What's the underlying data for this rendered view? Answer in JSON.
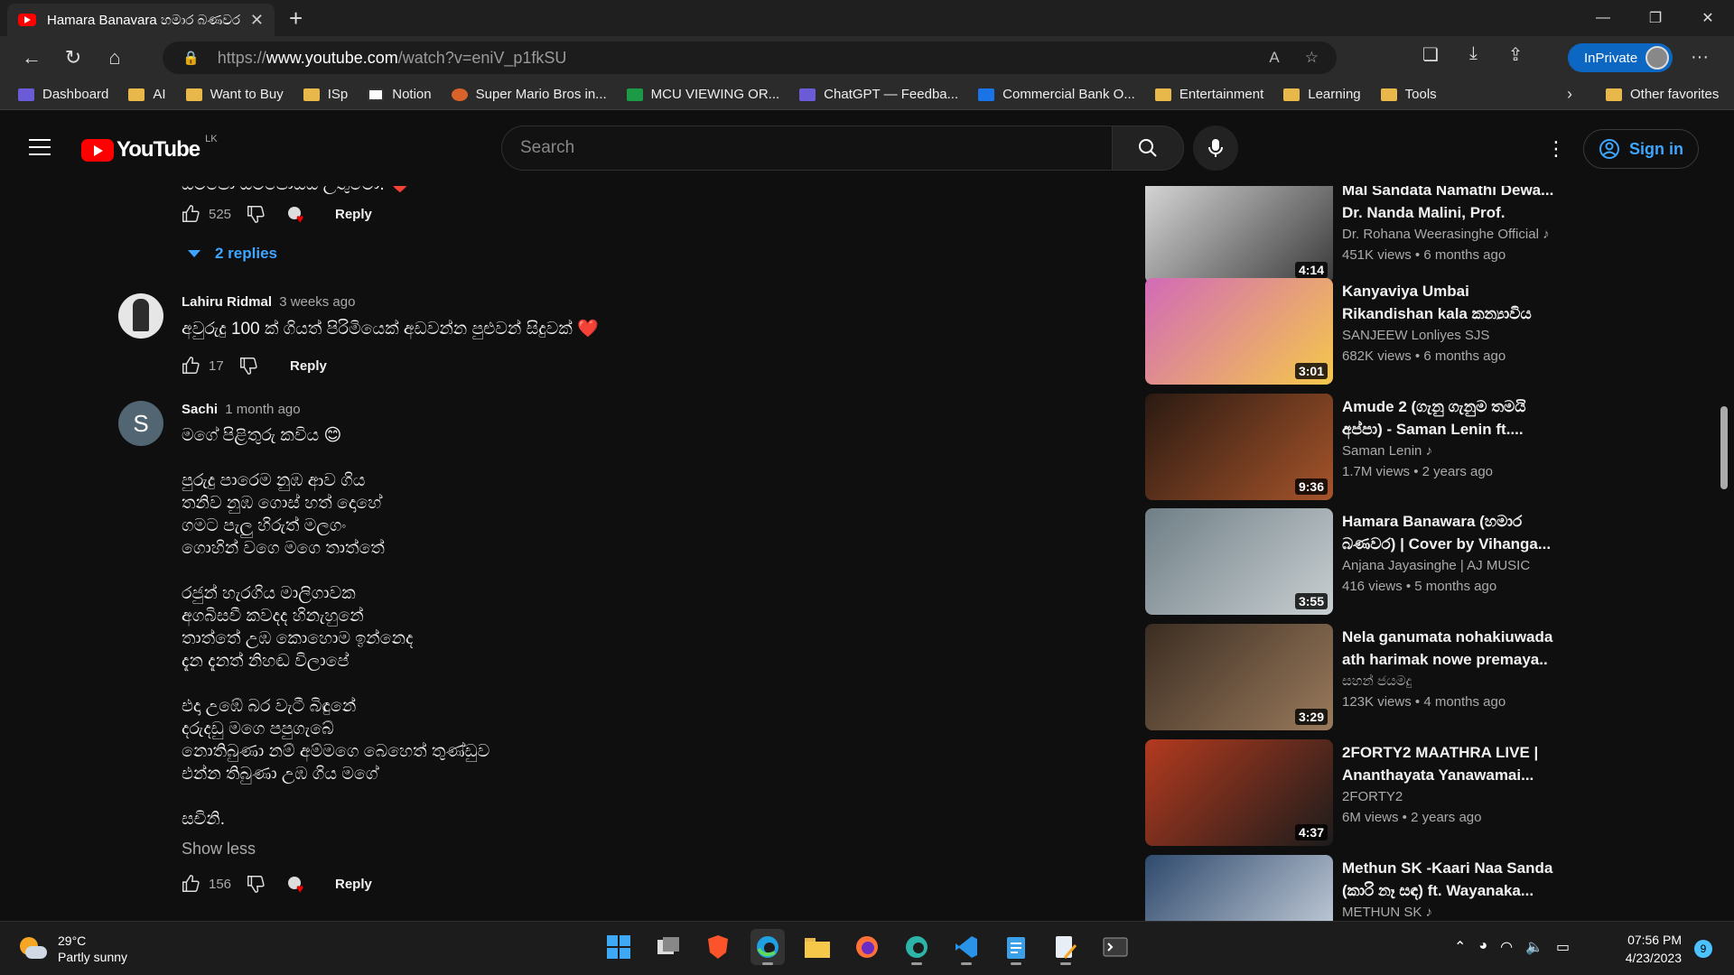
{
  "browser": {
    "tab_title": "Hamara Banavara හමාර බණවර",
    "url_prefix": "https://",
    "url_domain": "www.youtube.com",
    "url_path": "/watch?v=eniV_p1fkSU",
    "inprivate_label": "InPrivate",
    "bookmarks": [
      {
        "label": "Dashboard",
        "icon": "dashboard-icon"
      },
      {
        "label": "AI",
        "icon": "folder-icon"
      },
      {
        "label": "Want to Buy",
        "icon": "folder-icon"
      },
      {
        "label": "ISp",
        "icon": "folder-icon"
      },
      {
        "label": "Notion",
        "icon": "notion-icon"
      },
      {
        "label": "Super Mario Bros in...",
        "icon": "mario-icon"
      },
      {
        "label": "MCU VIEWING OR...",
        "icon": "sheets-icon"
      },
      {
        "label": "ChatGPT — Feedba...",
        "icon": "form-icon"
      },
      {
        "label": "Commercial Bank O...",
        "icon": "bank-icon"
      },
      {
        "label": "Entertainment",
        "icon": "folder-icon"
      },
      {
        "label": "Learning",
        "icon": "folder-icon"
      },
      {
        "label": "Tools",
        "icon": "folder-icon"
      }
    ],
    "other_favorites": "Other favorites"
  },
  "youtube": {
    "logo_text": "YouTube",
    "country": "LK",
    "search_placeholder": "Search",
    "sign_in": "Sign in"
  },
  "comments": {
    "top_partial_text": "සමපෝ සමපෝසය උතුමො. ❤️",
    "top_likes": "525",
    "replies_label": "2 replies",
    "reply_label": "Reply",
    "items": [
      {
        "author": "Lahiru Ridmal",
        "time": "3 weeks ago",
        "text": "අවුරුදු 100 ක් ගියත් පිරිමියෙක් අඩවන්න පුළුවන් සිදුවක් ❤️",
        "likes": "17"
      },
      {
        "author": "Sachi",
        "initial": "S",
        "time": "1 month ago",
        "lines": [
          "මගේ පිළිතුරු කවිය 😊",
          "",
          "පුරුදු පාරෙම නුඹ ආව ගිය",
          "තනිව නුඹ ගොස් හත් දොහේ",
          "ගමට පැලු හිරුත් මලගං",
          "ගොහින් වගෙ මගෙ තාත්තේ",
          "",
          "රජුන් හැරගිය මාලිගාවක",
          "අගබිසවී කවදද හිනැහුනේ",
          "තාත්තේ උඹ කොහොම ඉන්නෙද",
          "දැන දැනත් නිහඬ විලාපේ",
          "",
          "එදා උඹේ බර වැටී බිඳුනේ",
          "දරුදඩු මගෙ පපුගැබේ",
          "නොතිබුණා නම් අම්මගෙ බෙහෙත් තුණ්ඩුව",
          "එන්න තිබුණා උඹ ගිය මගේ",
          "",
          "සචිනි."
        ],
        "show_less": "Show less",
        "likes": "156"
      }
    ]
  },
  "related": [
    {
      "title": "Mal Sandata Namathi Dewa... Dr. Nanda Malini, Prof. Sunil...",
      "channel": "Dr. Rohana Weerasinghe Official",
      "music": true,
      "views": "451K views",
      "age": "6 months ago",
      "duration": "4:14",
      "thumb_colors": [
        "#d9d9d9",
        "#3a3a3a"
      ]
    },
    {
      "title": "Kanyaviya Umbai Rikandishan kala කන්‍යාවිය උඹයි...",
      "channel": "SANJEEW Lonliyes SJS",
      "music": false,
      "views": "682K views",
      "age": "6 months ago",
      "duration": "3:01",
      "thumb_colors": [
        "#d26ab8",
        "#f5c84a"
      ]
    },
    {
      "title": "Amude 2 (ගැනු ගැනුම තමයි අප්පා) - Saman Lenin ft....",
      "channel": "Saman Lenin",
      "music": true,
      "views": "1.7M views",
      "age": "2 years ago",
      "duration": "9:36",
      "thumb_colors": [
        "#2a1a12",
        "#a6542a"
      ]
    },
    {
      "title": "Hamara Banawara (හමාර බණවර) | Cover by Vihanga...",
      "channel": "Anjana Jayasinghe | AJ MUSIC",
      "music": false,
      "views": "416 views",
      "age": "5 months ago",
      "duration": "3:55",
      "thumb_colors": [
        "#6f7f86",
        "#c9cfd2"
      ]
    },
    {
      "title": "Nela ganumata nohakiuwada ath harimak nowe premaya..",
      "channel": "සහන් ජයමදු",
      "music": false,
      "views": "123K views",
      "age": "4 months ago",
      "duration": "3:29",
      "thumb_colors": [
        "#3b2d22",
        "#9a7a5c"
      ]
    },
    {
      "title": "2FORTY2 MAATHRA LIVE | Ananthayata Yanawamai...",
      "channel": "2FORTY2",
      "music": false,
      "views": "6M views",
      "age": "2 years ago",
      "duration": "4:37",
      "thumb_colors": [
        "#b33a1e",
        "#1c1c1c"
      ]
    },
    {
      "title": "Methun SK -Kaari Naa Sanda (කාරි නෑ සඳ) ft. Wayanaka...",
      "channel": "METHUN SK",
      "music": true,
      "views": "",
      "age": "",
      "duration": "",
      "thumb_colors": [
        "#2f4a6d",
        "#d0d8e2"
      ]
    }
  ],
  "taskbar": {
    "temperature": "29°C",
    "condition": "Partly sunny",
    "time": "07:56 PM",
    "date": "4/23/2023",
    "notifications": "9"
  }
}
